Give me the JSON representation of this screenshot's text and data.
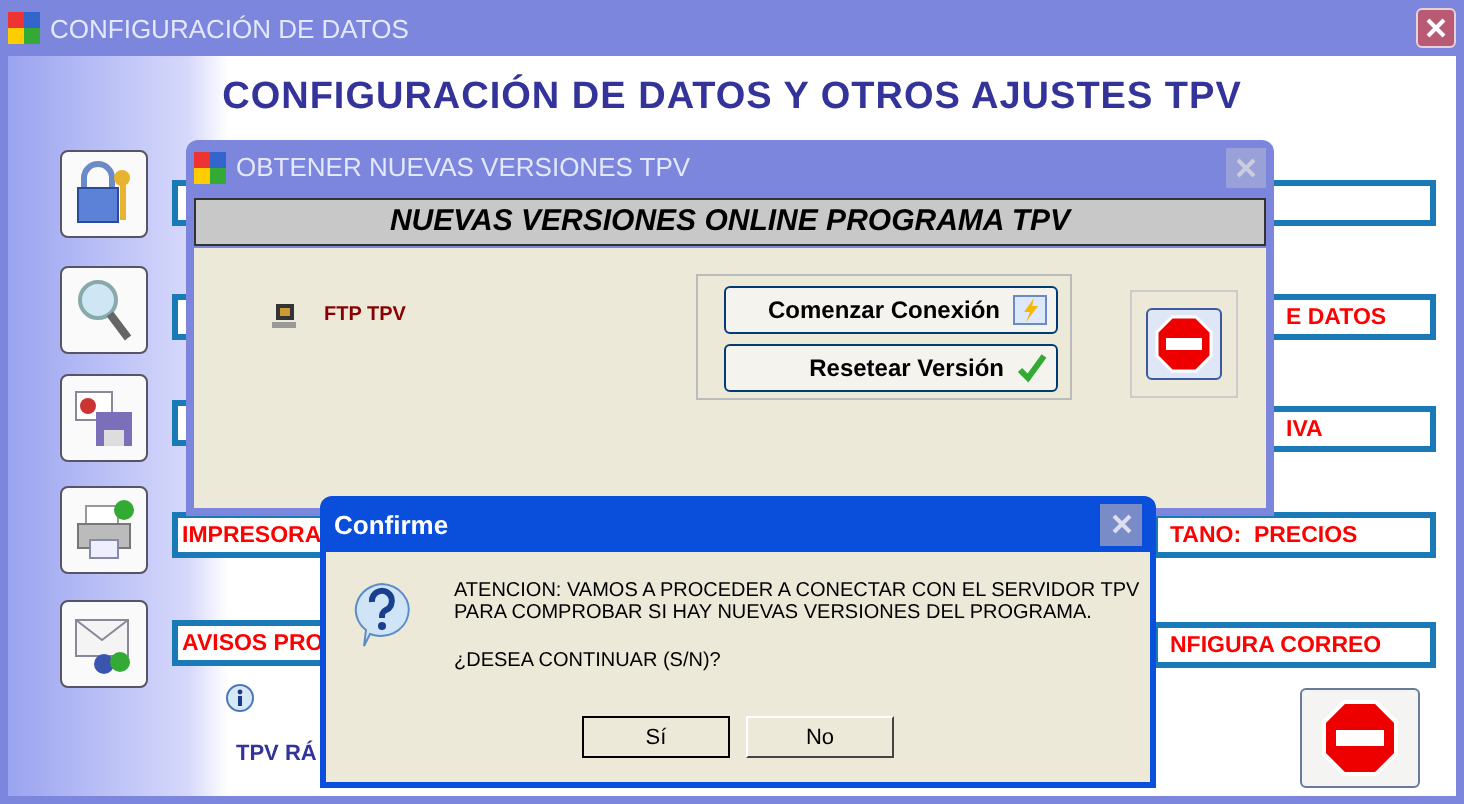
{
  "window": {
    "title": "CONFIGURACIÓN DE DATOS"
  },
  "heading": "CONFIGURACIÓN DE DATOS Y OTROS AJUSTES TPV",
  "rows": [
    {},
    {
      "right_text": "E DATOS"
    },
    {
      "right_text": "IVA"
    },
    {
      "left_text": "IMPRESORA",
      "right_text": "TANO:  PRECIOS"
    },
    {
      "left_text": "AVISOS PRO",
      "right_text": "NFIGURA CORREO"
    }
  ],
  "info_text": "TPV RÁ",
  "versions_window": {
    "title": "OBTENER NUEVAS VERSIONES TPV",
    "header": "NUEVAS VERSIONES ONLINE PROGRAMA TPV",
    "ftp_label": "FTP TPV",
    "buttons": [
      {
        "label": "Comenzar Conexión"
      },
      {
        "label": "Resetear Versión"
      }
    ]
  },
  "confirm_dialog": {
    "title": "Confirme",
    "message_lines": [
      "ATENCION: VAMOS A PROCEDER A CONECTAR CON EL SERVIDOR TPV",
      "PARA COMPROBAR SI HAY NUEVAS VERSIONES DEL PROGRAMA."
    ],
    "question": "¿DESEA CONTINUAR (S/N)?",
    "buttons": [
      "Sí",
      "No"
    ]
  }
}
